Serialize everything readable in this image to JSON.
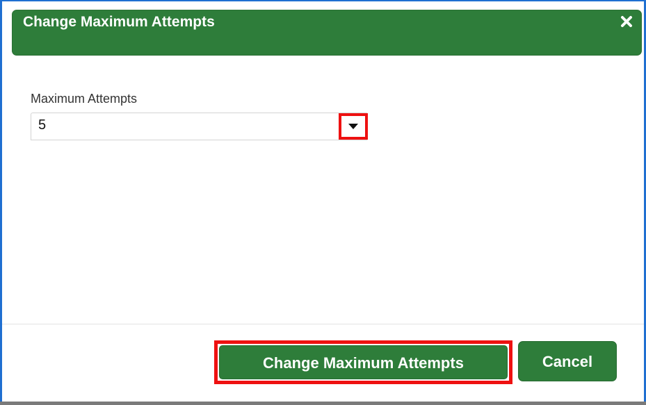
{
  "dialog": {
    "title": "Change Maximum Attempts",
    "close_icon": "close-icon"
  },
  "form": {
    "field_label": "Maximum Attempts",
    "selected_value": "5",
    "dropdown_icon": "chevron-down-icon"
  },
  "footer": {
    "primary_label": "Change Maximum Attempts",
    "cancel_label": "Cancel"
  },
  "colors": {
    "header_green": "#2e7d3a",
    "highlight_red": "#ee1111",
    "frame_blue": "#1f6fd1"
  }
}
